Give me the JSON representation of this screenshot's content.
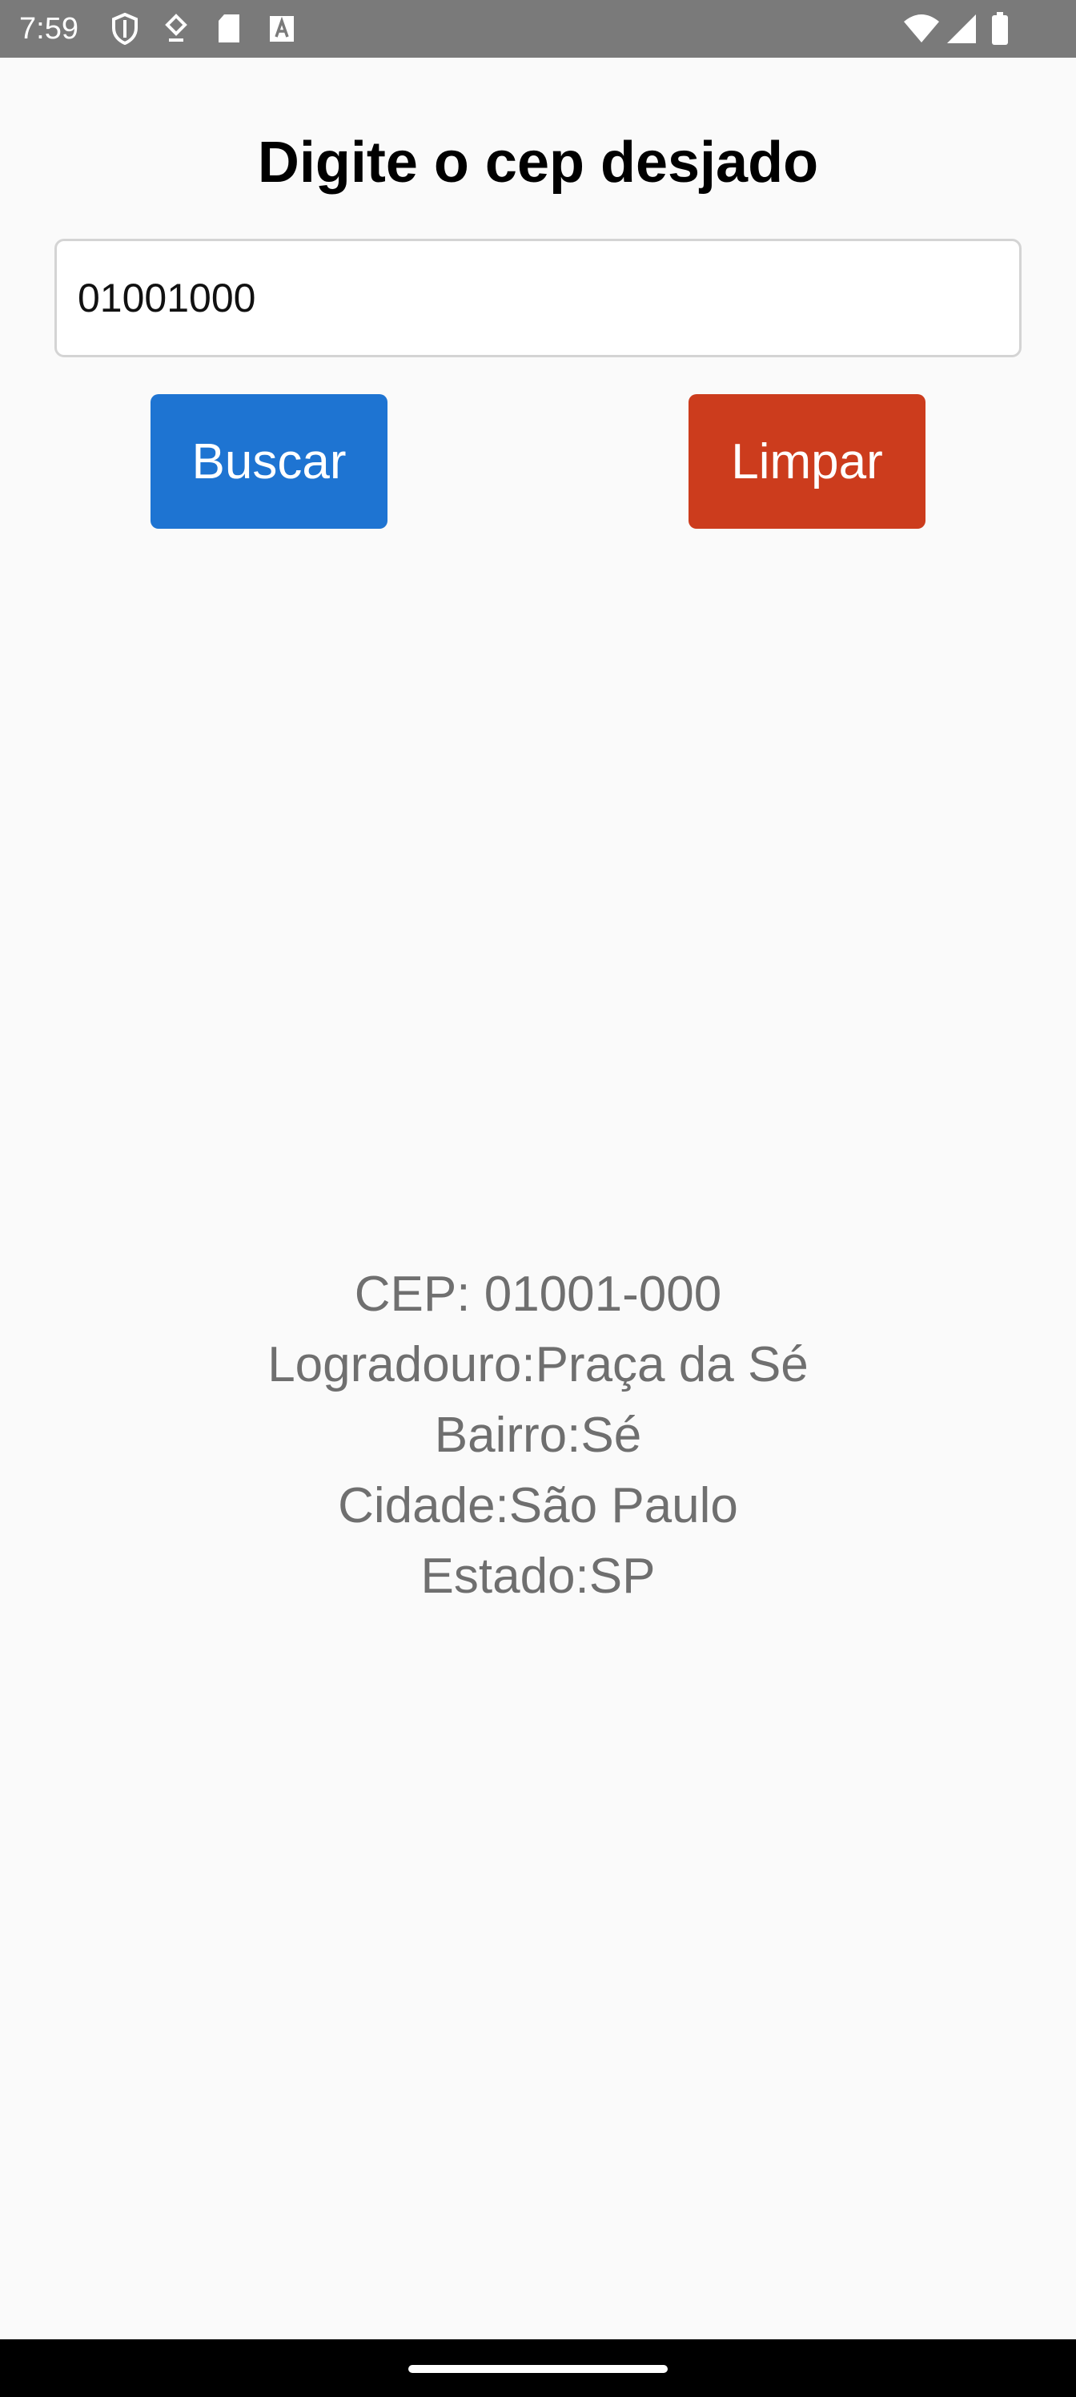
{
  "status_bar": {
    "time": "7:59",
    "left_icons": [
      "shield-icon",
      "download-icon",
      "sd-card-icon",
      "keyboard-a-icon"
    ],
    "right_icons": [
      "wifi-icon",
      "signal-icon",
      "battery-icon"
    ],
    "background": "#7a7a7a"
  },
  "page": {
    "title": "Digite o cep desjado",
    "cep_input": {
      "value": "01001000",
      "placeholder": ""
    },
    "buscar_label": "Buscar",
    "limpar_label": "Limpar",
    "buscar_color": "#1e74d2",
    "limpar_color": "#cc3c1d"
  },
  "result": {
    "cep": "CEP: 01001-000",
    "logradouro": "Logradouro:Praça da Sé",
    "bairro": "Bairro:Sé",
    "cidade": "Cidade:São Paulo",
    "estado": "Estado:SP"
  }
}
